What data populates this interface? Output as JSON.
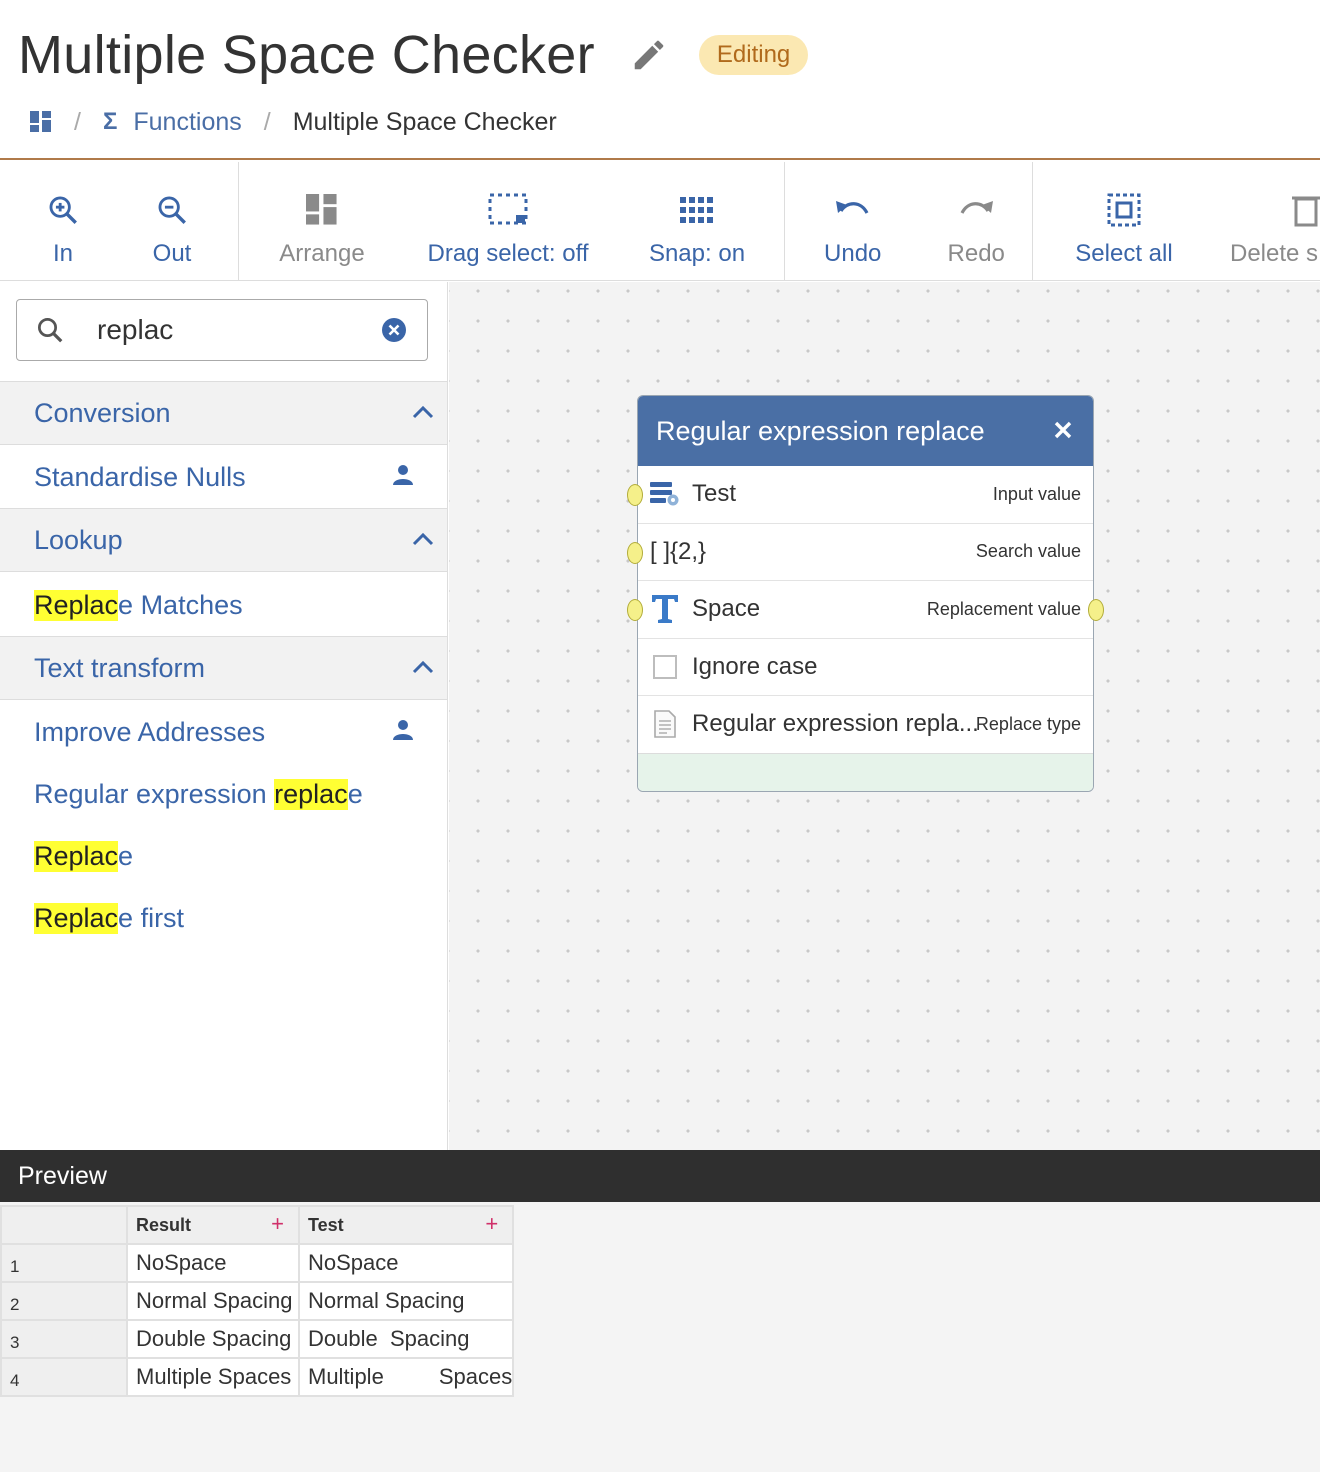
{
  "header": {
    "title": "Multiple Space Checker",
    "badge": "Editing",
    "breadcrumb": {
      "section": "Functions",
      "separator": "/",
      "current": "Multiple Space Checker"
    }
  },
  "toolbar": {
    "zoom_in": "In",
    "zoom_out": "Out",
    "arrange": "Arrange",
    "drag_select": "Drag select: off",
    "snap": "Snap: on",
    "undo": "Undo",
    "redo": "Redo",
    "select_all": "Select all",
    "delete": "Delete s"
  },
  "sidebar": {
    "search": {
      "value": "replac",
      "placeholder": ""
    },
    "categories": [
      {
        "label": "Conversion",
        "items": [
          {
            "label": "Standardise Nulls",
            "user": true
          }
        ]
      },
      {
        "label": "Lookup",
        "items": [
          {
            "highlight": "Replac",
            "rest": "e Matches"
          }
        ]
      },
      {
        "label": "Text transform",
        "items": [
          {
            "label": "Improve Addresses",
            "user": true
          },
          {
            "prefix": "Regular expression ",
            "highlight": "replac",
            "rest": "e"
          },
          {
            "highlight": "Replac",
            "rest": "e"
          },
          {
            "highlight": "Replac",
            "rest": "e first"
          }
        ]
      }
    ]
  },
  "node": {
    "title": "Regular expression replace",
    "rows": [
      {
        "value": "Test",
        "tag": "Input value",
        "icon": "data-column-icon"
      },
      {
        "value": "[ ]{2,}",
        "tag": "Search value",
        "icon": "none"
      },
      {
        "value": "Space",
        "tag": "Replacement value",
        "icon": "text-t-icon"
      },
      {
        "value": "Ignore case",
        "tag": "",
        "icon": "checkbox-icon"
      },
      {
        "value": "Regular expression repla...",
        "tag": "Replace type",
        "icon": "document-icon"
      }
    ]
  },
  "preview": {
    "title": "Preview",
    "columns": [
      "Result",
      "Test"
    ],
    "rows": [
      {
        "n": "1",
        "result": "NoSpace",
        "test": "NoSpace"
      },
      {
        "n": "2",
        "result": "Normal Spacing",
        "test": "Normal Spacing"
      },
      {
        "n": "3",
        "result": "Double Spacing",
        "test": "Double  Spacing"
      },
      {
        "n": "4",
        "result": "Multiple Spaces",
        "test": "Multiple         Spaces"
      }
    ]
  },
  "colors": {
    "accent": "#3a65a8",
    "node_header": "#4a6fa5",
    "badge_bg": "#fbe8b2",
    "badge_text": "#b06a1c",
    "highlight": "#ffff33",
    "header_rule": "#b07a4a",
    "preview_bar": "#2f2f2f"
  }
}
